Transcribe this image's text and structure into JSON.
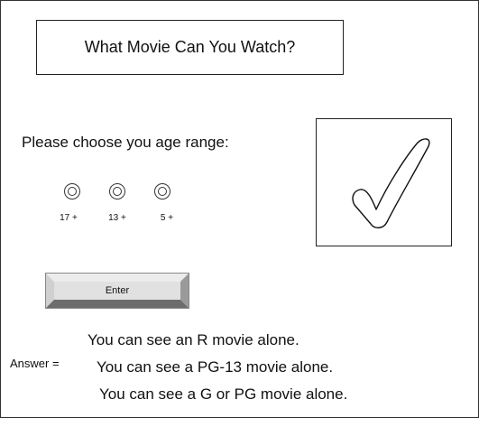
{
  "title": "What Movie Can You Watch?",
  "prompt": "Please choose you age range:",
  "options": [
    {
      "label": "17 +"
    },
    {
      "label": "13 +"
    },
    {
      "label": "5 +"
    }
  ],
  "enter_label": "Enter",
  "answer_label": "Answer =",
  "answers": [
    "You can see an R movie alone.",
    "You can see a PG-13 movie alone.",
    "You can see a G or PG movie alone."
  ],
  "check_icon": "checkmark-icon"
}
